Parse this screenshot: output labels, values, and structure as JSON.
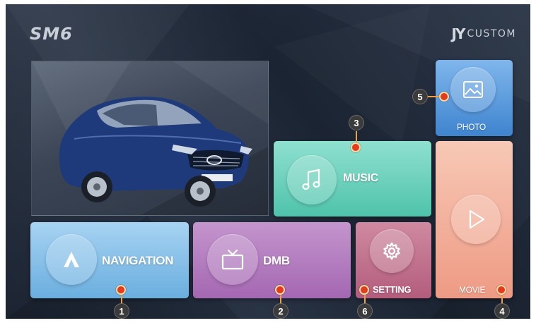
{
  "header": {
    "brand": "SM6",
    "logo_mark": "JY",
    "logo_text": "CUSTOM"
  },
  "tiles": {
    "navigation": {
      "label": "NAVIGATION",
      "icon": "navigation-arrow-icon"
    },
    "dmb": {
      "label": "DMB",
      "icon": "tv-icon"
    },
    "setting": {
      "label": "SETTING",
      "icon": "gear-icon"
    },
    "music": {
      "label": "MUSIC",
      "icon": "music-note-icon"
    },
    "photo": {
      "label": "PHOTO",
      "icon": "image-icon"
    },
    "movie": {
      "label": "MOVIE",
      "icon": "play-icon"
    }
  },
  "callouts": {
    "c1": "1",
    "c2": "2",
    "c3": "3",
    "c4": "4",
    "c5": "5",
    "c6": "6"
  },
  "colors": {
    "navigation": "#6aaedf",
    "dmb": "#a467b2",
    "setting": "#b35c7c",
    "music": "#4fc3ab",
    "photo": "#3f84cf",
    "movie": "#ee9a84",
    "callout_dot": "#e23b1e",
    "callout_badge": "#3b3b3b"
  }
}
